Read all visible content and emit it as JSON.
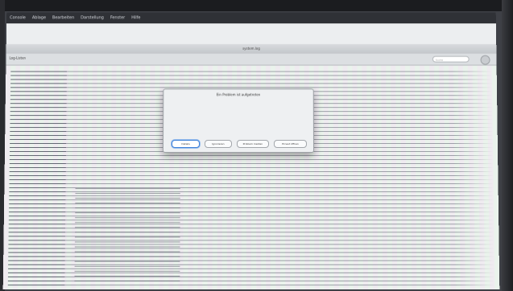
{
  "menubar": {
    "items": [
      "Console",
      "Ablage",
      "Bearbeiten",
      "Darstellung",
      "Fenster",
      "Hilfe"
    ]
  },
  "window": {
    "title": "system.log"
  },
  "toolbar": {
    "tab_label": "Log-Listen",
    "search_placeholder": "Suche"
  },
  "dialog": {
    "title": "Ein Problem ist aufgetreten",
    "text1": "",
    "text2": "",
    "text3": "",
    "buttons": [
      "Details",
      "Ignorieren",
      "Problem melden",
      "Erneut öffnen"
    ]
  }
}
